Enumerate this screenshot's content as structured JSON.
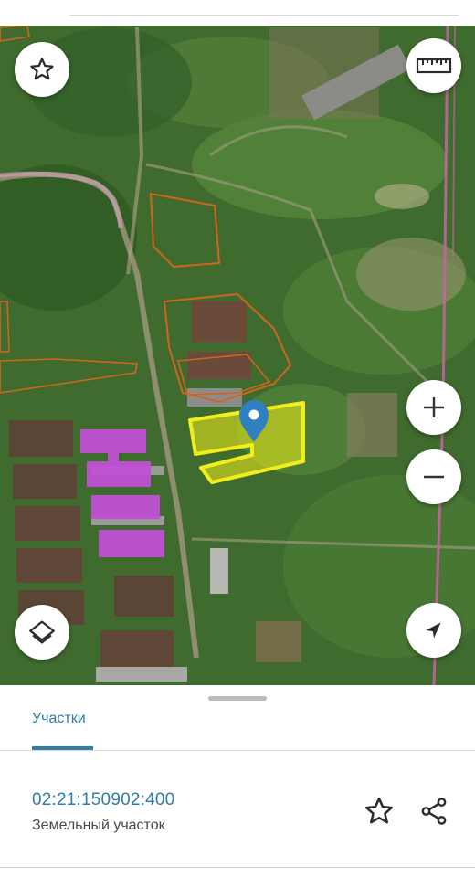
{
  "map": {
    "kind": "satellite",
    "selected_parcel_color": "#f2ee1b",
    "parcel_outline_color": "#d0661e",
    "highlight_color": "#c44fd8",
    "boundary_color": "#d06aa8",
    "marker_color": "#2f7fc1"
  },
  "controls": {
    "favorite": "star-icon",
    "ruler": "ruler-icon",
    "zoom_in": "plus-icon",
    "zoom_out": "minus-icon",
    "layers": "layers-icon",
    "locate": "navigation-arrow-icon"
  },
  "sheet": {
    "tab_label": "Участки",
    "parcel_id": "02:21:150902:400",
    "parcel_type": "Земельный участок",
    "accent_color": "#2e7da8"
  }
}
